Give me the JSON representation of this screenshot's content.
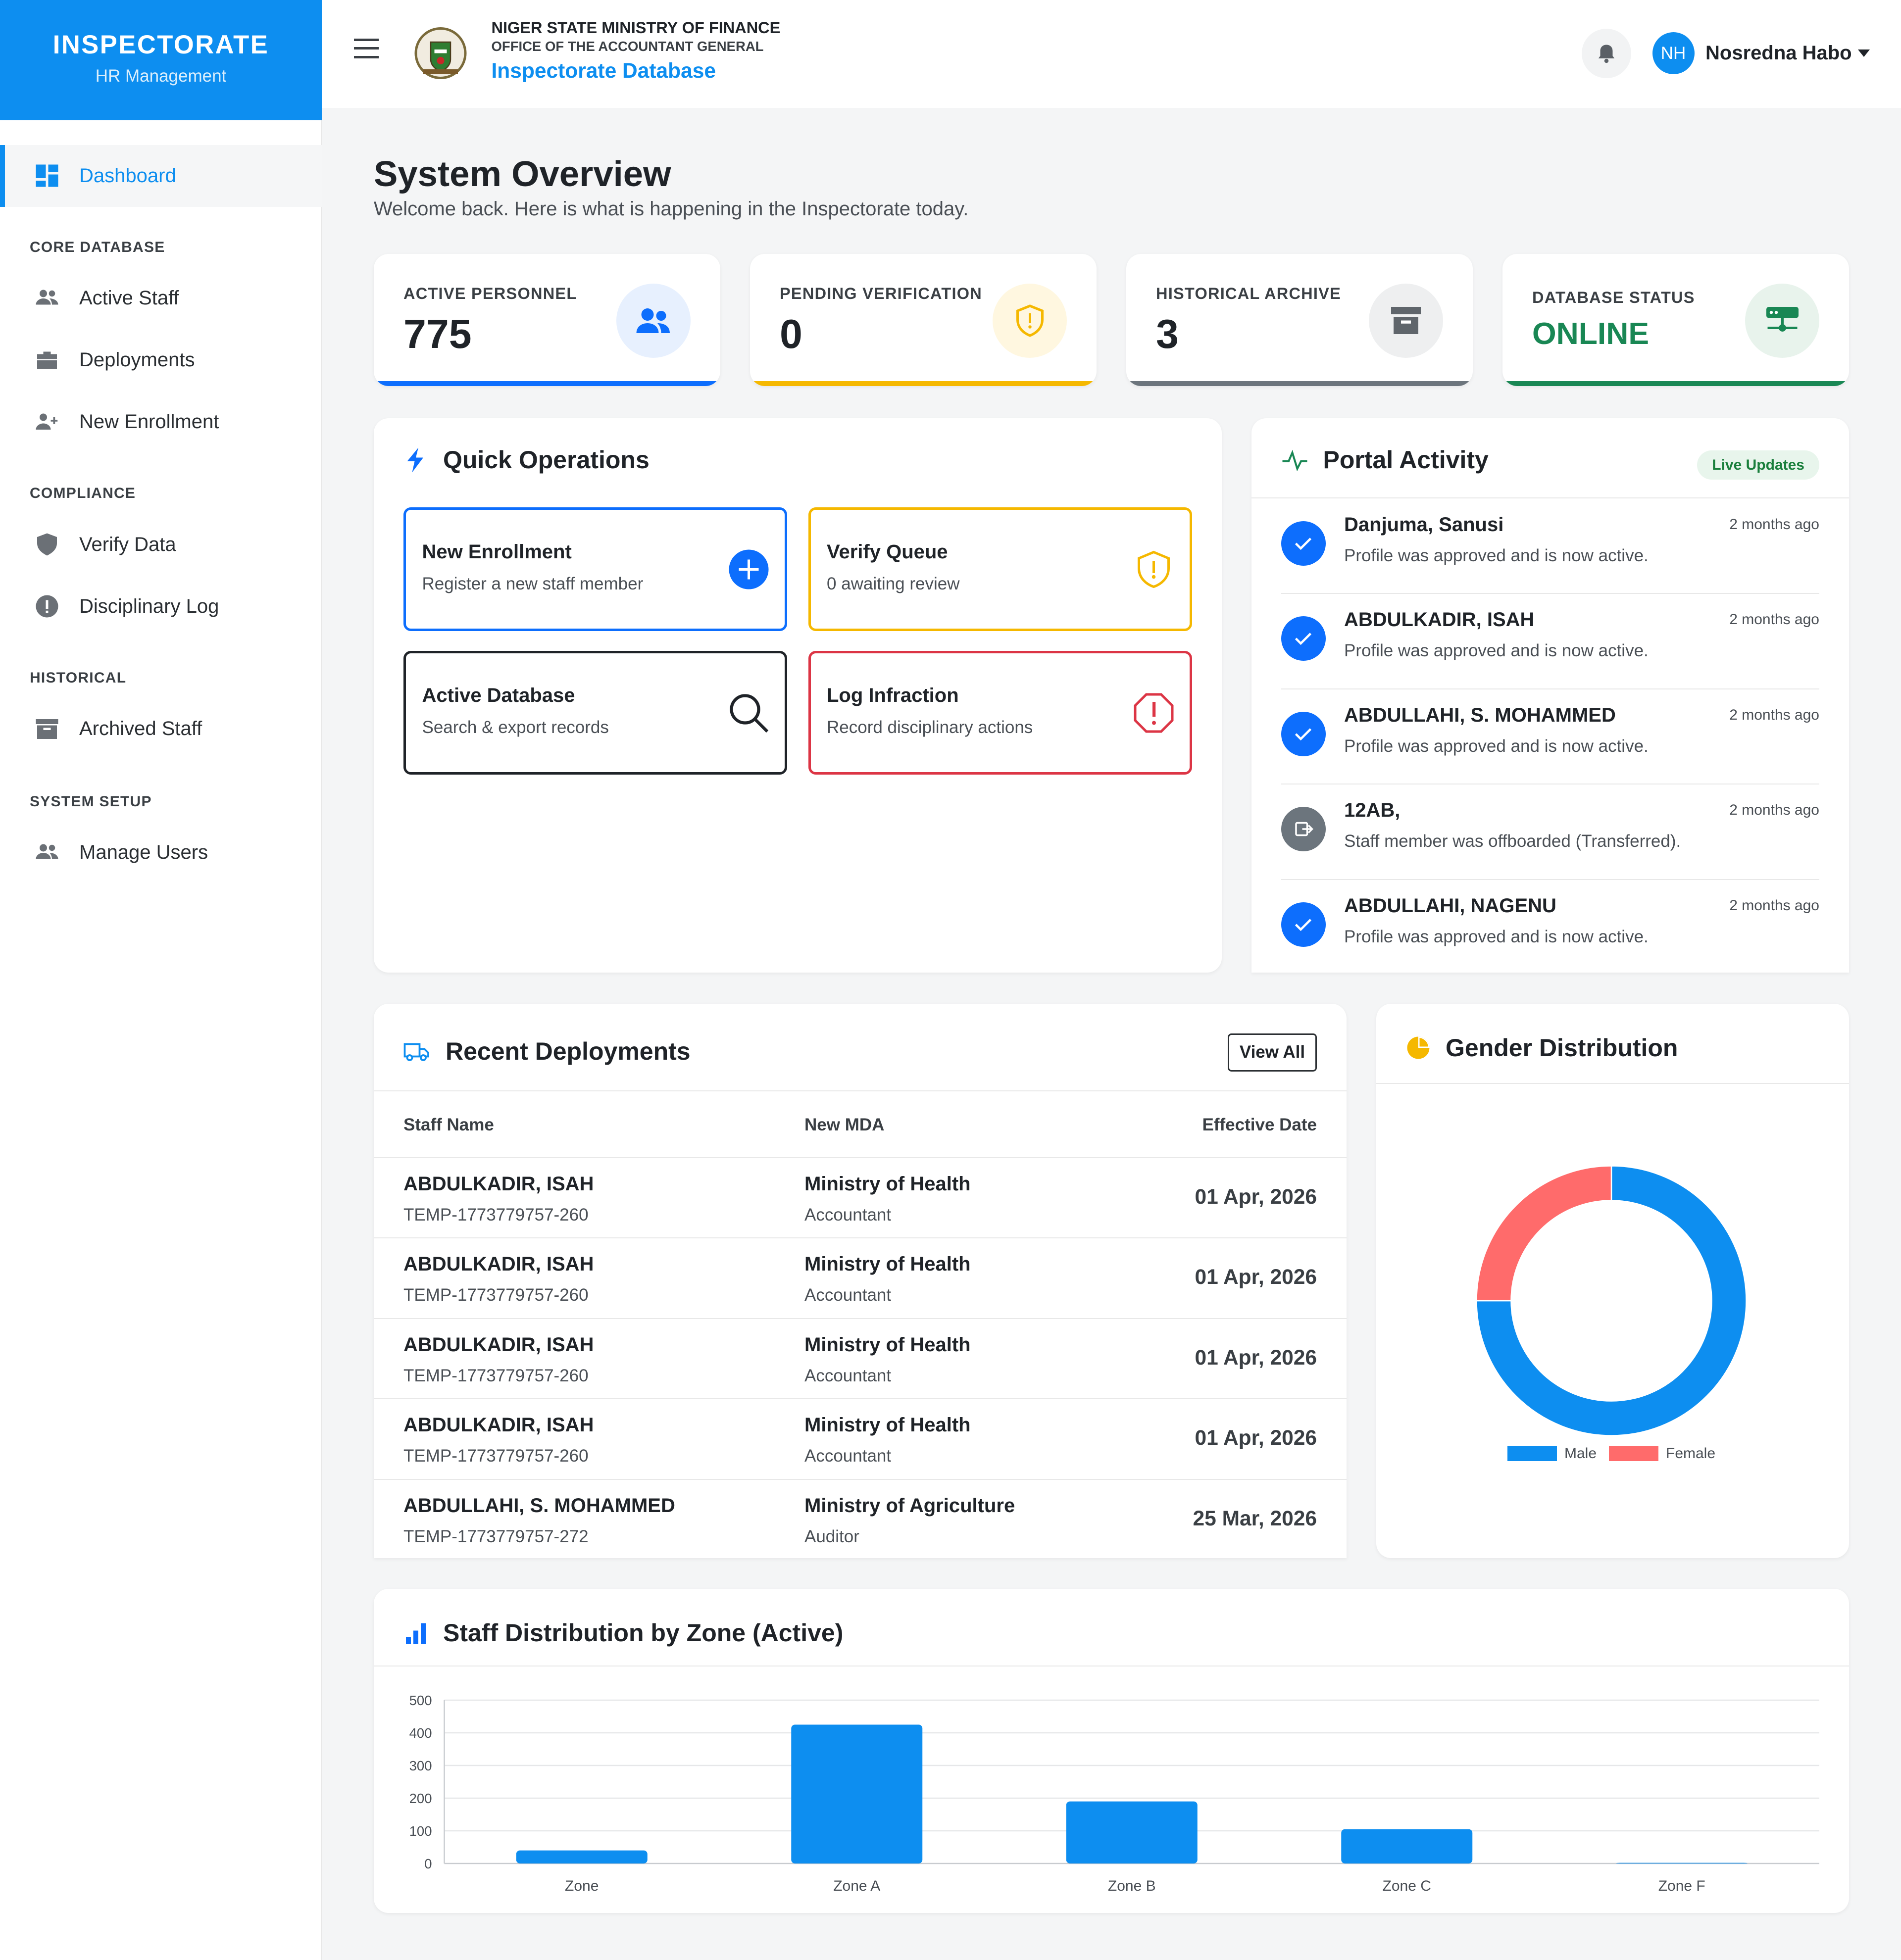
{
  "brand": {
    "title": "INSPECTORATE",
    "subtitle": "HR Management"
  },
  "sidebar": {
    "dashboard": "Dashboard",
    "sections": [
      "CORE DATABASE",
      "COMPLIANCE",
      "HISTORICAL",
      "SYSTEM SETUP"
    ],
    "items": [
      {
        "label": "Active Staff",
        "icon": "users-icon"
      },
      {
        "label": "Deployments",
        "icon": "briefcase-icon"
      },
      {
        "label": "New Enrollment",
        "icon": "user-plus-icon"
      },
      {
        "label": "Verify Data",
        "icon": "shield-icon"
      },
      {
        "label": "Disciplinary Log",
        "icon": "alert-circle-icon"
      },
      {
        "label": "Archived Staff",
        "icon": "archive-icon"
      },
      {
        "label": "Manage Users",
        "icon": "users-icon"
      }
    ]
  },
  "header": {
    "org_line1": "NIGER STATE MINISTRY OF FINANCE",
    "org_line2": "OFFICE OF THE ACCOUNTANT GENERAL",
    "app_name": "Inspectorate Database",
    "user_initials": "NH",
    "user_name": "Nosredna Habo"
  },
  "page": {
    "title": "System Overview",
    "subtitle": "Welcome back. Here is what is happening in the Inspectorate today."
  },
  "stats": [
    {
      "label": "ACTIVE PERSONNEL",
      "value": "775",
      "color": "#0d6efd"
    },
    {
      "label": "PENDING VERIFICATION",
      "value": "0",
      "color": "#f5b800"
    },
    {
      "label": "HISTORICAL ARCHIVE",
      "value": "3",
      "color": "#6c757d"
    },
    {
      "label": "DATABASE STATUS",
      "value": "ONLINE",
      "color": "#198754"
    }
  ],
  "quick_ops": {
    "title": "Quick Operations",
    "items": [
      {
        "title": "New Enrollment",
        "subtitle": "Register a new staff member"
      },
      {
        "title": "Verify Queue",
        "subtitle": "0 awaiting review"
      },
      {
        "title": "Active Database",
        "subtitle": "Search & export records"
      },
      {
        "title": "Log Infraction",
        "subtitle": "Record disciplinary actions"
      }
    ]
  },
  "activity": {
    "title": "Portal Activity",
    "badge": "Live Updates",
    "items": [
      {
        "name": "Danjuma, Sanusi",
        "desc": "Profile was approved and is now active.",
        "time": "2 months ago",
        "type": "approved"
      },
      {
        "name": "ABDULKADIR, ISAH",
        "desc": "Profile was approved and is now active.",
        "time": "2 months ago",
        "type": "approved"
      },
      {
        "name": "ABDULLAHI, S. MOHAMMED",
        "desc": "Profile was approved and is now active.",
        "time": "2 months ago",
        "type": "approved"
      },
      {
        "name": "12AB,",
        "desc": "Staff member was offboarded (Transferred).",
        "time": "2 months ago",
        "type": "offboarded"
      },
      {
        "name": "ABDULLAHI, NAGENU",
        "desc": "Profile was approved and is now active.",
        "time": "2 months ago",
        "type": "approved"
      }
    ]
  },
  "deployments": {
    "title": "Recent Deployments",
    "view_all": "View All",
    "columns": [
      "Staff Name",
      "New MDA",
      "Effective Date"
    ],
    "rows": [
      {
        "name": "ABDULKADIR, ISAH",
        "id": "TEMP-1773779757-260",
        "mda": "Ministry of Health",
        "role": "Accountant",
        "date": "01 Apr, 2026"
      },
      {
        "name": "ABDULKADIR, ISAH",
        "id": "TEMP-1773779757-260",
        "mda": "Ministry of Health",
        "role": "Accountant",
        "date": "01 Apr, 2026"
      },
      {
        "name": "ABDULKADIR, ISAH",
        "id": "TEMP-1773779757-260",
        "mda": "Ministry of Health",
        "role": "Accountant",
        "date": "01 Apr, 2026"
      },
      {
        "name": "ABDULKADIR, ISAH",
        "id": "TEMP-1773779757-260",
        "mda": "Ministry of Health",
        "role": "Accountant",
        "date": "01 Apr, 2026"
      },
      {
        "name": "ABDULLAHI, S. MOHAMMED",
        "id": "TEMP-1773779757-272",
        "mda": "Ministry of Agriculture",
        "role": "Auditor",
        "date": "25 Mar, 2026"
      }
    ]
  },
  "gender": {
    "title": "Gender Distribution",
    "chart_data": {
      "type": "pie",
      "labels": [
        "Male",
        "Female"
      ],
      "values": [
        75,
        25
      ],
      "colors": [
        "#0d8ef0",
        "#ff6b6b"
      ]
    }
  },
  "zones": {
    "title": "Staff Distribution by Zone (Active)",
    "chart_data": {
      "type": "bar",
      "categories": [
        "Zone",
        "Zone A",
        "Zone B",
        "Zone C",
        "Zone F"
      ],
      "values": [
        40,
        425,
        190,
        105,
        2
      ],
      "ylim": [
        0,
        500
      ],
      "yticks": [
        0,
        100,
        200,
        300,
        400,
        500
      ],
      "color": "#0d8ef0"
    }
  }
}
